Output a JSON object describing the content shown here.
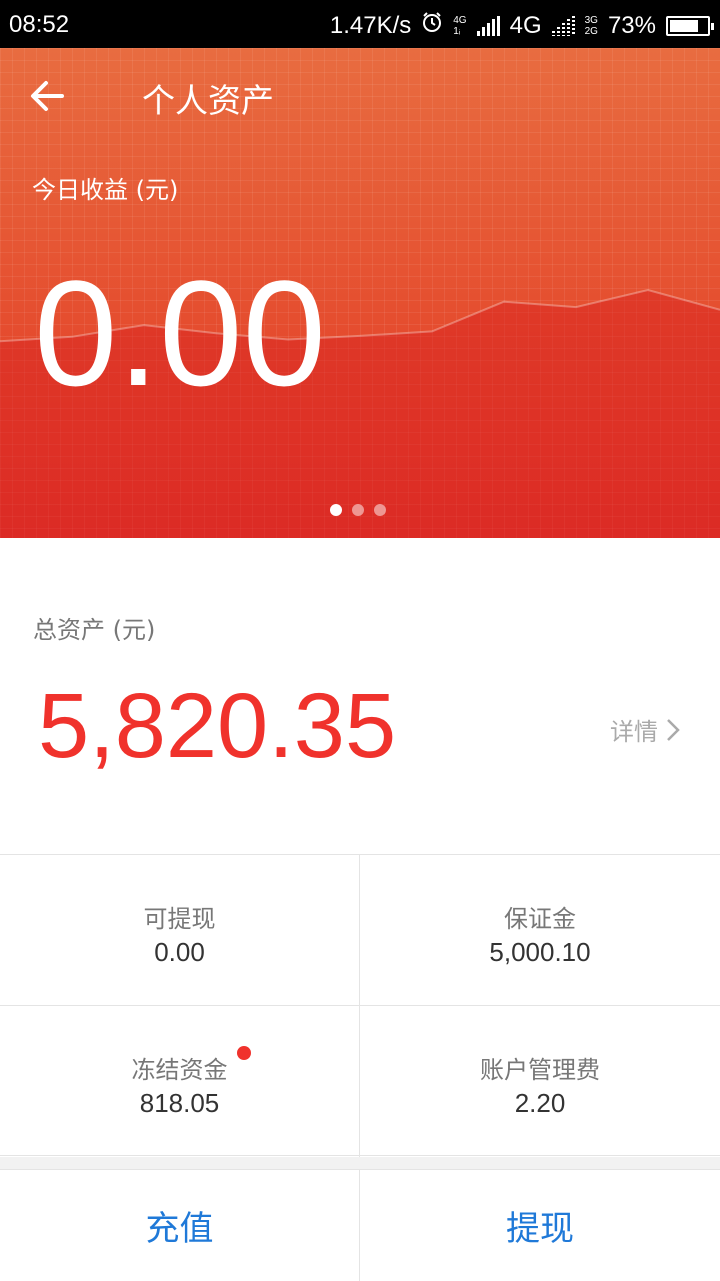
{
  "status": {
    "time": "08:52",
    "speed": "1.47K/s",
    "net_small_a": "4G",
    "net_small_b": "1ᵢ",
    "net_label": "4G",
    "net_small_c": "3G",
    "net_small_d": "2G",
    "battery": "73%",
    "icons": [
      "alarm-icon",
      "signal-icon",
      "battery-icon"
    ]
  },
  "header": {
    "title": "个人资产",
    "back_icon": "arrow-left-icon"
  },
  "hero": {
    "today_label": "今日收益 (元)",
    "today_value": "0.00",
    "pages": 3,
    "active_page": 0,
    "trend_values": [
      0.43,
      0.48,
      0.61,
      0.52,
      0.45,
      0.49,
      0.54,
      0.87,
      0.81,
      1.0,
      0.78
    ]
  },
  "summary": {
    "total_label": "总资产 (元)",
    "total_value": "5,820.35",
    "details_label": "详情",
    "details_icon": "chevron-right-icon"
  },
  "balances": [
    {
      "label": "可提现",
      "value": "0.00"
    },
    {
      "label": "保证金",
      "value": "5,000.10"
    },
    {
      "label": "冻结资金",
      "value": "818.05"
    },
    {
      "label": "账户管理费",
      "value": "2.20"
    }
  ],
  "actions": {
    "recharge": "充值",
    "withdraw": "提现"
  },
  "colors": {
    "accent_red": "#f0322c",
    "action_blue": "#1f79d8",
    "hero_top": "#e86c40",
    "hero_bottom": "#e1352a"
  }
}
